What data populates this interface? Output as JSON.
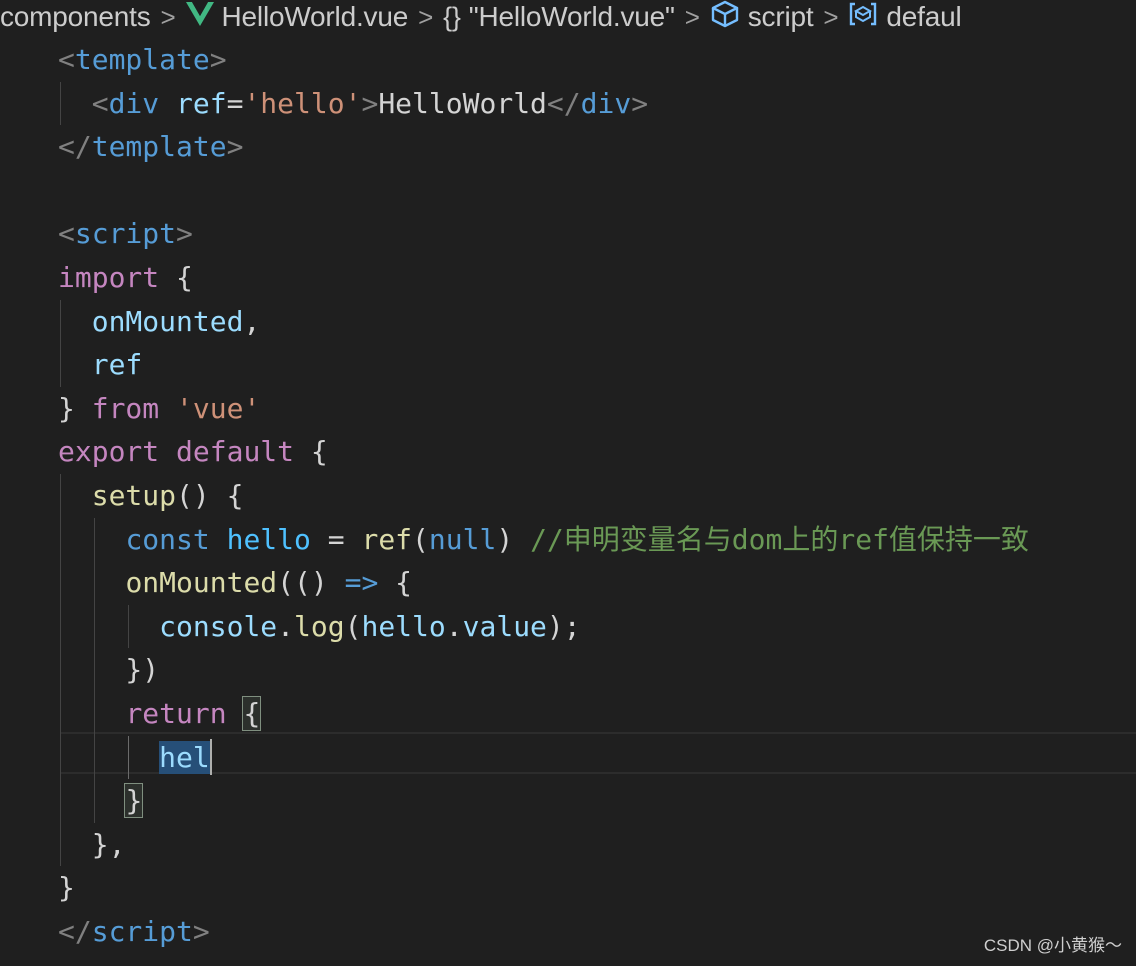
{
  "breadcrumb": {
    "items": [
      {
        "label": "components",
        "icon": null
      },
      {
        "label": "HelloWorld.vue",
        "icon": "vue-logo-icon"
      },
      {
        "label": "\"HelloWorld.vue\"",
        "icon": "braces-icon"
      },
      {
        "label": "script",
        "icon": "cube-icon"
      },
      {
        "label": "defaul",
        "icon": "variable-icon"
      }
    ],
    "separator": ">"
  },
  "editor": {
    "lines": [
      [
        {
          "t": "<",
          "c": "punct"
        },
        {
          "t": "template",
          "c": "tag"
        },
        {
          "t": ">",
          "c": "punct"
        }
      ],
      [
        {
          "t": "  <",
          "c": "punct"
        },
        {
          "t": "div",
          "c": "tag"
        },
        {
          "t": " ",
          "c": "plain"
        },
        {
          "t": "ref",
          "c": "attr"
        },
        {
          "t": "=",
          "c": "eq"
        },
        {
          "t": "'hello'",
          "c": "string"
        },
        {
          "t": ">",
          "c": "punct"
        },
        {
          "t": "HelloWorld",
          "c": "text"
        },
        {
          "t": "</",
          "c": "punct"
        },
        {
          "t": "div",
          "c": "tag"
        },
        {
          "t": ">",
          "c": "punct"
        }
      ],
      [
        {
          "t": "</",
          "c": "punct"
        },
        {
          "t": "template",
          "c": "tag"
        },
        {
          "t": ">",
          "c": "punct"
        }
      ],
      [],
      [
        {
          "t": "<",
          "c": "punct"
        },
        {
          "t": "script",
          "c": "tag"
        },
        {
          "t": ">",
          "c": "punct"
        }
      ],
      [
        {
          "t": "import",
          "c": "keyword"
        },
        {
          "t": " {",
          "c": "plain"
        }
      ],
      [
        {
          "t": "  onMounted",
          "c": "var"
        },
        {
          "t": ",",
          "c": "plain"
        }
      ],
      [
        {
          "t": "  ref",
          "c": "var"
        }
      ],
      [
        {
          "t": "} ",
          "c": "plain"
        },
        {
          "t": "from",
          "c": "keyword"
        },
        {
          "t": " ",
          "c": "plain"
        },
        {
          "t": "'vue'",
          "c": "string"
        }
      ],
      [
        {
          "t": "export",
          "c": "keyword"
        },
        {
          "t": " ",
          "c": "plain"
        },
        {
          "t": "default",
          "c": "keyword"
        },
        {
          "t": " {",
          "c": "plain"
        }
      ],
      [
        {
          "t": "  ",
          "c": "plain"
        },
        {
          "t": "setup",
          "c": "func"
        },
        {
          "t": "() {",
          "c": "plain"
        }
      ],
      [
        {
          "t": "    ",
          "c": "plain"
        },
        {
          "t": "const",
          "c": "storage"
        },
        {
          "t": " ",
          "c": "plain"
        },
        {
          "t": "hello",
          "c": "const"
        },
        {
          "t": " = ",
          "c": "plain"
        },
        {
          "t": "ref",
          "c": "func"
        },
        {
          "t": "(",
          "c": "plain"
        },
        {
          "t": "null",
          "c": "storage"
        },
        {
          "t": ") ",
          "c": "plain"
        },
        {
          "t": "//申明变量名与dom上的ref值保持一致",
          "c": "comment"
        }
      ],
      [
        {
          "t": "    ",
          "c": "plain"
        },
        {
          "t": "onMounted",
          "c": "func"
        },
        {
          "t": "(() ",
          "c": "plain"
        },
        {
          "t": "=>",
          "c": "storage"
        },
        {
          "t": " {",
          "c": "plain"
        }
      ],
      [
        {
          "t": "      ",
          "c": "plain"
        },
        {
          "t": "console",
          "c": "var"
        },
        {
          "t": ".",
          "c": "plain"
        },
        {
          "t": "log",
          "c": "func"
        },
        {
          "t": "(",
          "c": "plain"
        },
        {
          "t": "hello",
          "c": "var"
        },
        {
          "t": ".",
          "c": "plain"
        },
        {
          "t": "value",
          "c": "var"
        },
        {
          "t": ");",
          "c": "plain"
        }
      ],
      [
        {
          "t": "    })",
          "c": "plain"
        }
      ],
      [
        {
          "t": "    ",
          "c": "plain"
        },
        {
          "t": "return",
          "c": "keyword"
        },
        {
          "t": " ",
          "c": "plain"
        },
        {
          "t": "{",
          "c": "plain",
          "match": true
        }
      ],
      [
        {
          "t": "      ",
          "c": "plain"
        },
        {
          "t": "hel",
          "c": "var",
          "sel": true,
          "cursor": true
        }
      ],
      [
        {
          "t": "    ",
          "c": "plain"
        },
        {
          "t": "}",
          "c": "plain",
          "match": true
        }
      ],
      [
        {
          "t": "  },",
          "c": "plain"
        }
      ],
      [
        {
          "t": "}",
          "c": "plain"
        }
      ],
      [
        {
          "t": "</",
          "c": "punct"
        },
        {
          "t": "script",
          "c": "tag"
        },
        {
          "t": ">",
          "c": "punct"
        }
      ]
    ]
  },
  "watermark": "CSDN @小黄猴～"
}
